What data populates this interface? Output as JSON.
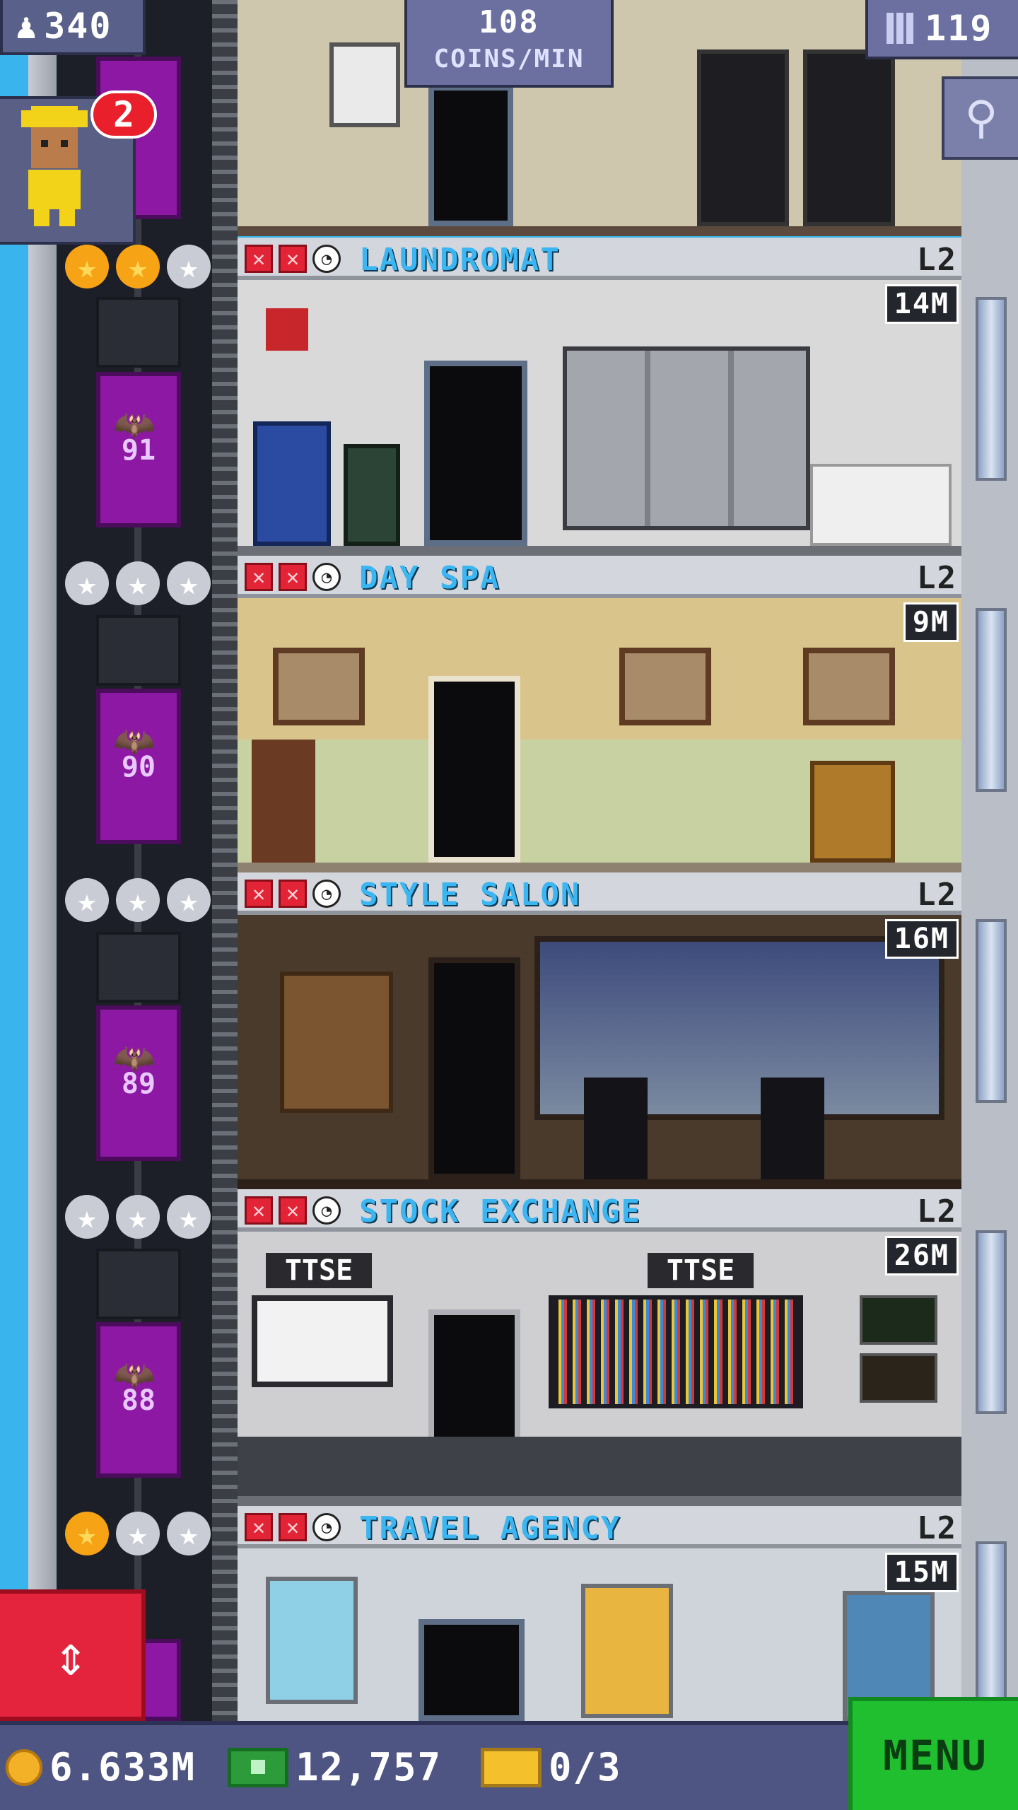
{
  "hud": {
    "population": "340",
    "coins_per_min_value": "108",
    "coins_per_min_label": "COINS/MIN",
    "floor_count": "119",
    "visitor_badge": "2"
  },
  "floors": [
    {
      "name": "LAUNDROMAT",
      "level": "L2",
      "timer": "14M",
      "elevator_number": "91",
      "stars": [
        "gold",
        "gold",
        "silver"
      ]
    },
    {
      "name": "DAY SPA",
      "level": "L2",
      "timer": "9M",
      "elevator_number": "90",
      "stars": [
        "silver",
        "silver",
        "silver"
      ]
    },
    {
      "name": "STYLE SALON",
      "level": "L2",
      "timer": "16M",
      "elevator_number": "89",
      "stars": [
        "silver",
        "silver",
        "silver"
      ]
    },
    {
      "name": "STOCK EXCHANGE",
      "level": "L2",
      "timer": "26M",
      "elevator_number": "88",
      "stars": [
        "silver",
        "silver",
        "silver"
      ],
      "signs": [
        "TTSE",
        "TTSE"
      ]
    },
    {
      "name": "TRAVEL AGENCY",
      "level": "L2",
      "timer": "15M",
      "stars": [
        "gold",
        "silver",
        "silver"
      ]
    }
  ],
  "bottom": {
    "coins": "6.633M",
    "bux": "12,757",
    "tickets": "0/3",
    "menu_label": "MENU"
  },
  "icons": {
    "population": "person-icon",
    "floors": "building-icon",
    "search": "magnifier-icon",
    "elevator": "up-down-arrows-icon"
  },
  "colors": {
    "sky": "#33b2ea",
    "elevator": "#8c18a4",
    "floor_name": "#3bb6f2",
    "menu": "#1fbf2f",
    "elevator_button": "#e4243d"
  }
}
